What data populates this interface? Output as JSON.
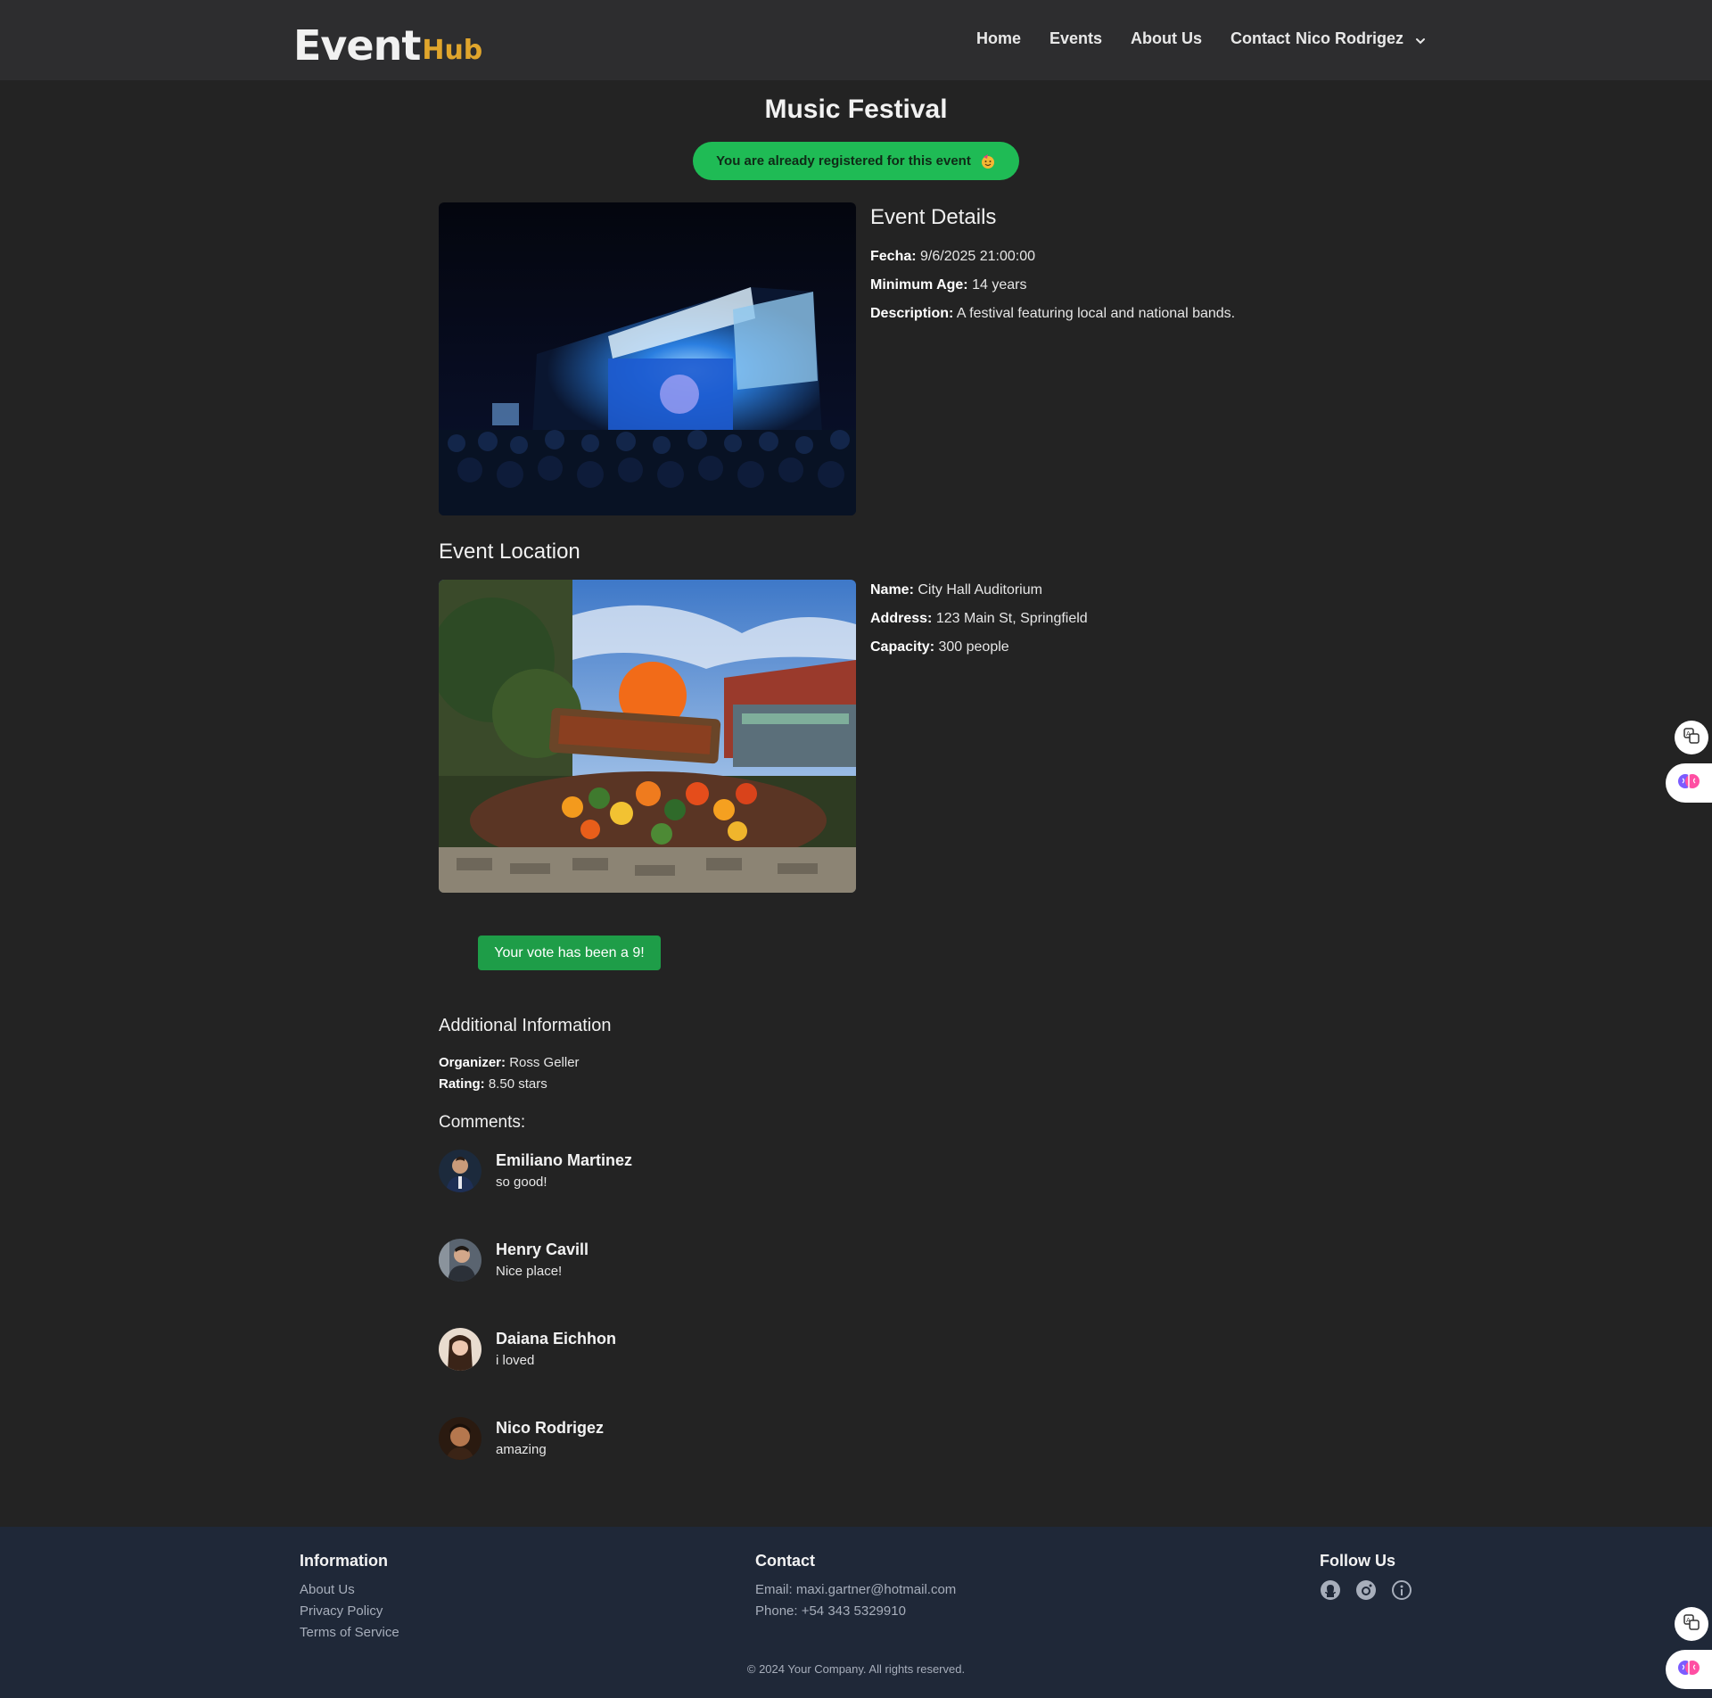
{
  "nav": {
    "logo_main": "Event",
    "logo_sub": "Hub",
    "links": [
      "Home",
      "Events",
      "About Us",
      "Contact"
    ],
    "user": "Nico Rodrigez"
  },
  "event": {
    "title": "Music Festival",
    "registered_badge": "You are already registered for this event",
    "details_heading": "Event Details",
    "fecha_label": "Fecha:",
    "fecha_value": "9/6/2025 21:00:00",
    "age_label": "Minimum Age:",
    "age_value": "14 years",
    "desc_label": "Description:",
    "desc_value": "A festival featuring local and national bands."
  },
  "location": {
    "heading": "Event Location",
    "name_label": "Name:",
    "name_value": "City Hall Auditorium",
    "address_label": "Address:",
    "address_value": "123 Main St, Springfield",
    "capacity_label": "Capacity:",
    "capacity_value": "300 people"
  },
  "vote": {
    "label": "Your vote has been a 9!"
  },
  "additional": {
    "heading": "Additional Information",
    "organizer_label": "Organizer:",
    "organizer_value": "Ross Geller",
    "rating_label": "Rating:",
    "rating_value": "8.50 stars"
  },
  "comments": {
    "heading": "Comments:",
    "items": [
      {
        "name": "Emiliano Martinez",
        "text": "so good!"
      },
      {
        "name": "Henry Cavill",
        "text": "Nice place!"
      },
      {
        "name": "Daiana Eichhon",
        "text": "i loved"
      },
      {
        "name": "Nico Rodrigez",
        "text": "amazing"
      }
    ]
  },
  "footer": {
    "info_heading": "Information",
    "info_links": [
      "About Us",
      "Privacy Policy",
      "Terms of Service"
    ],
    "contact_heading": "Contact",
    "email": "Email: maxi.gartner@hotmail.com",
    "phone": "Phone: +54 343 5329910",
    "follow_heading": "Follow Us",
    "social_icons": [
      "github-icon",
      "instagram-icon",
      "info-icon"
    ],
    "copyright": "© 2024 Your Company. All rights reserved."
  },
  "colors": {
    "badge_green": "#1fbb55",
    "vote_green": "#1e9d48",
    "logo_accent": "#e0a52c",
    "footer_bg": "#1f2838"
  }
}
